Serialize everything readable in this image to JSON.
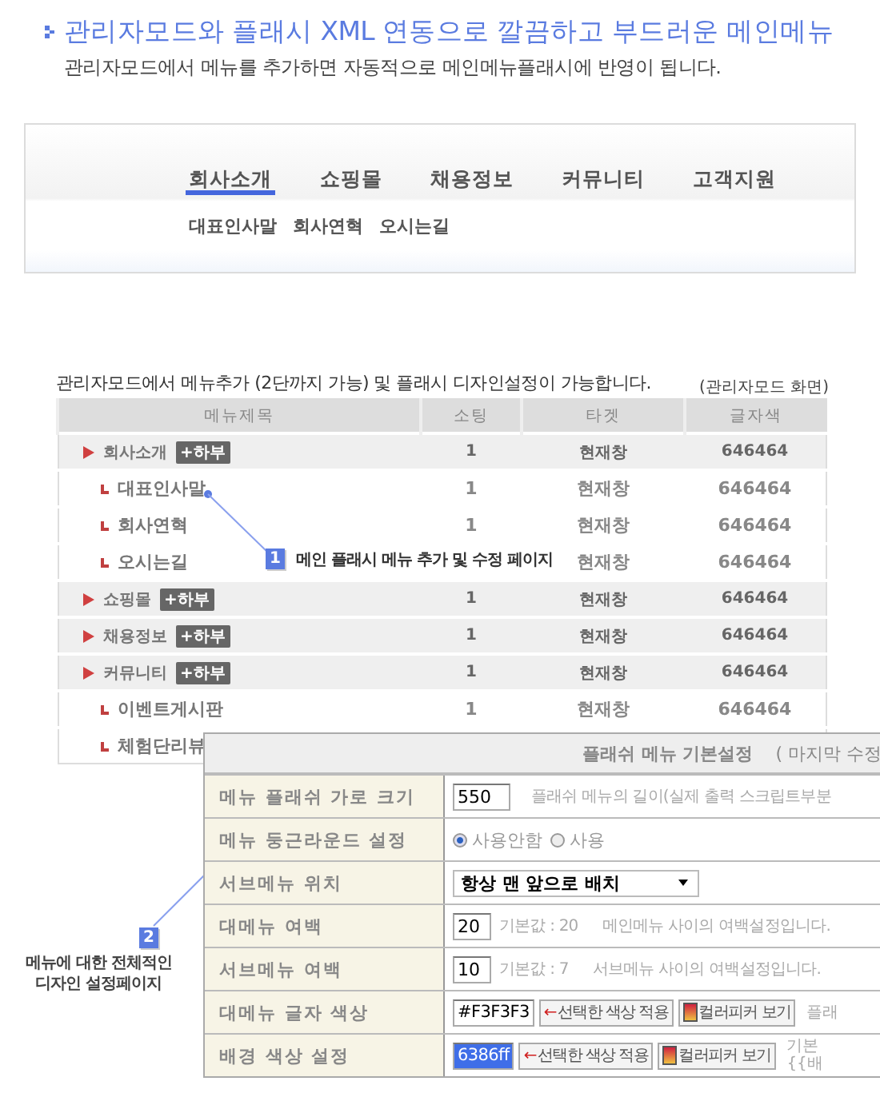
{
  "header": {
    "title": "관리자모드와 플래시 XML 연동으로 깔끔하고 부드러운 메인메뉴",
    "subtitle": "관리자모드에서 메뉴를 추가하면 자동적으로 메인메뉴플래시에 반영이 됩니다."
  },
  "menu_preview": {
    "tabs": [
      {
        "label": "회사소개",
        "selected": true
      },
      {
        "label": "쇼핑몰",
        "selected": false
      },
      {
        "label": "채용정보",
        "selected": false
      },
      {
        "label": "커뮤니티",
        "selected": false
      },
      {
        "label": "고객지원",
        "selected": false
      }
    ],
    "submenu": [
      "대표인사말",
      "회사연혁",
      "오시는길"
    ]
  },
  "admin_caption": "관리자모드에서 메뉴추가 (2단까지 가능) 및 플래시 디자인설정이 가능합니다.",
  "admin_note": "(관리자모드 화면)",
  "table": {
    "columns": [
      "메뉴제목",
      "소팅",
      "타겟",
      "글자색"
    ],
    "rows": [
      {
        "kind": "main",
        "title": "회사소개",
        "badge": "+하부",
        "sort": "1",
        "target": "현재창",
        "text_color": "646464"
      },
      {
        "kind": "sub",
        "title": "대표인사말",
        "sort": "1",
        "target": "현재창",
        "text_color": "646464"
      },
      {
        "kind": "sub",
        "title": "회사연혁",
        "sort": "1",
        "target": "현재창",
        "text_color": "646464"
      },
      {
        "kind": "sub",
        "title": "오시는길",
        "target": "현재창",
        "text_color": "646464"
      },
      {
        "kind": "main",
        "title": "쇼핑몰",
        "badge": "+하부",
        "sort": "1",
        "target": "현재창",
        "text_color": "646464"
      },
      {
        "kind": "main",
        "title": "채용정보",
        "badge": "+하부",
        "sort": "1",
        "target": "현재창",
        "text_color": "646464"
      },
      {
        "kind": "main",
        "title": "커뮤니티",
        "badge": "+하부",
        "sort": "1",
        "target": "현재창",
        "text_color": "646464"
      },
      {
        "kind": "sub",
        "title": "이벤트게시판",
        "sort": "1",
        "target": "현재창",
        "text_color": "646464"
      },
      {
        "kind": "sub",
        "title": "체험단리뷰"
      }
    ]
  },
  "callouts": [
    {
      "number": "1",
      "lines": [
        "메인 플래시 메뉴 추가 및 수정 페이지"
      ]
    },
    {
      "number": "2",
      "lines": [
        "메뉴에 대한 전체적인",
        "디자인 설정페이지"
      ]
    }
  ],
  "settings_panel": {
    "title": "플래쉬 메뉴 기본설정",
    "title_note": "( 마지막 수정",
    "rows": [
      {
        "kind": "input",
        "label": "메뉴 플래쉬 가로 크기",
        "value": "550",
        "note": "플래쉬 메뉴의 길이(실제 출력 스크립트부분"
      },
      {
        "kind": "radio",
        "label": "메뉴 둥근라운드 설정",
        "options": [
          {
            "label": "사용안함",
            "selected": true
          },
          {
            "label": "사용",
            "selected": false
          }
        ]
      },
      {
        "kind": "select",
        "label": "서브메뉴 위치",
        "value": "항상 맨 앞으로 배치"
      },
      {
        "kind": "input",
        "label": "대메뉴 여백",
        "value": "20",
        "default": "기본값 : 20",
        "note": "메인메뉴 사이의 여백설정입니다."
      },
      {
        "kind": "input",
        "label": "서브메뉴 여백",
        "value": "10",
        "default": "기본값 : 7",
        "note": "서브메뉴 사이의 여백설정입니다."
      },
      {
        "kind": "color",
        "label": "대메뉴 글자 색상",
        "value": "#F3F3F3",
        "highlighted": false,
        "apply_arrow": "←",
        "apply_button": "선택한 색상 적용",
        "picker_button": "컬러피커 보기",
        "note_lines": [
          "플래"
        ]
      },
      {
        "kind": "color",
        "label": "배경 색상 설정",
        "value": "6386ff",
        "highlighted": true,
        "apply_arrow": "←",
        "apply_button": "선택한 색상 적용",
        "picker_button": "컬러피커 보기",
        "note_lines": [
          "기본",
          "{{배"
        ]
      }
    ]
  }
}
